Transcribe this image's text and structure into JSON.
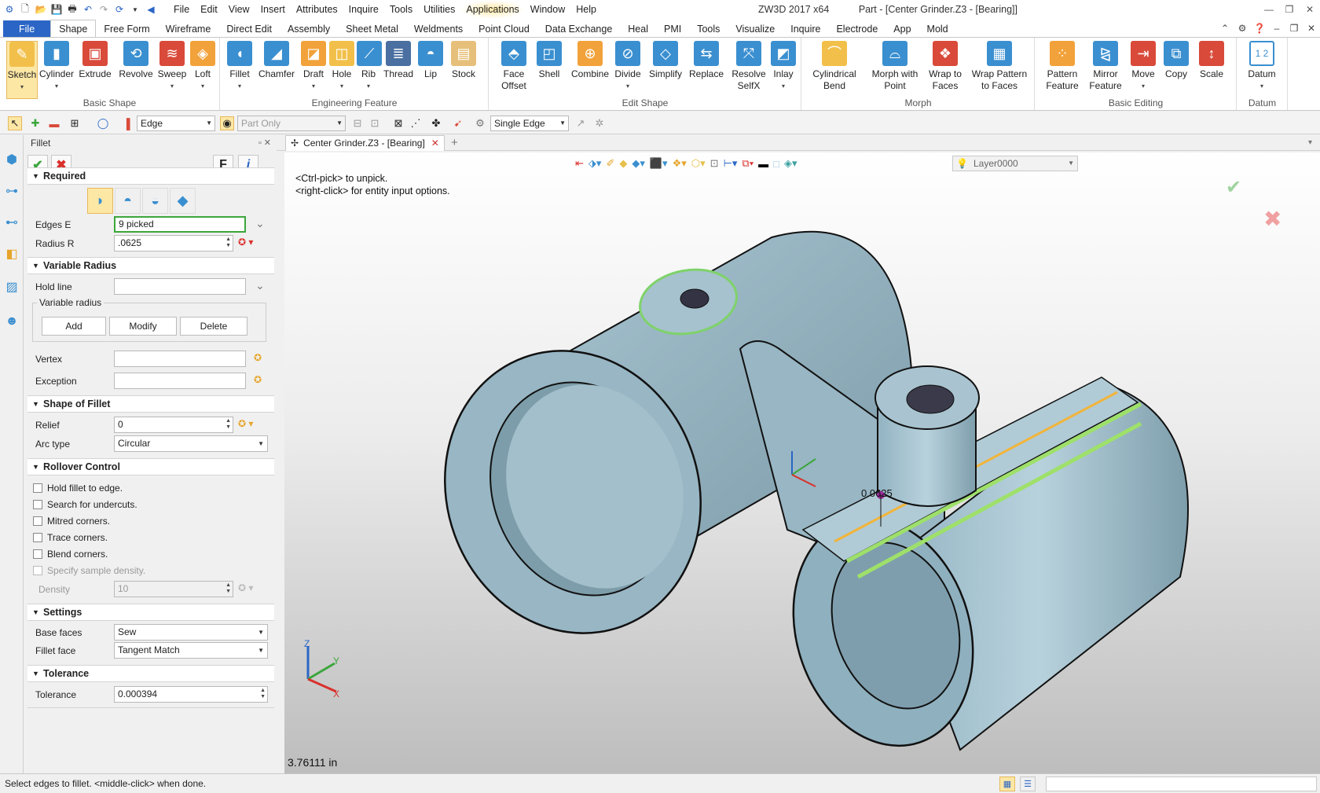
{
  "title_bar": {
    "app_version": "ZW3D 2017  x64",
    "doc_title": "Part - [Center Grinder.Z3 - [Bearing]]",
    "menu": [
      "File",
      "Edit",
      "View",
      "Insert",
      "Attributes",
      "Inquire",
      "Tools",
      "Utilities",
      "Applications",
      "Window",
      "Help"
    ]
  },
  "ribbon_tabs": [
    "Shape",
    "Free Form",
    "Wireframe",
    "Direct Edit",
    "Assembly",
    "Sheet Metal",
    "Weldments",
    "Point Cloud",
    "Data Exchange",
    "Heal",
    "PMI",
    "Tools",
    "Visualize",
    "Inquire",
    "Electrode",
    "App",
    "Mold"
  ],
  "file_tab": "File",
  "ribbon": {
    "basic_shape": {
      "label": "Basic Shape",
      "buttons": [
        {
          "l1": "Sketch",
          "l2": ""
        },
        {
          "l1": "Cylinder",
          "l2": ""
        },
        {
          "l1": "Extrude",
          "l2": ""
        },
        {
          "l1": "Revolve",
          "l2": ""
        },
        {
          "l1": "Sweep",
          "l2": ""
        },
        {
          "l1": "Loft",
          "l2": ""
        }
      ]
    },
    "engineering": {
      "label": "Engineering Feature",
      "buttons": [
        {
          "l1": "Fillet",
          "l2": ""
        },
        {
          "l1": "Chamfer",
          "l2": ""
        },
        {
          "l1": "Draft",
          "l2": ""
        },
        {
          "l1": "Hole",
          "l2": ""
        },
        {
          "l1": "Rib",
          "l2": ""
        },
        {
          "l1": "Thread",
          "l2": ""
        },
        {
          "l1": "Lip",
          "l2": ""
        },
        {
          "l1": "Stock",
          "l2": ""
        }
      ]
    },
    "edit_shape": {
      "label": "Edit Shape",
      "buttons": [
        {
          "l1": "Face",
          "l2": "Offset"
        },
        {
          "l1": "Shell",
          "l2": ""
        },
        {
          "l1": "Combine",
          "l2": ""
        },
        {
          "l1": "Divide",
          "l2": ""
        },
        {
          "l1": "Simplify",
          "l2": ""
        },
        {
          "l1": "Replace",
          "l2": ""
        },
        {
          "l1": "Resolve",
          "l2": "SelfX"
        },
        {
          "l1": "Inlay",
          "l2": ""
        }
      ]
    },
    "morph": {
      "label": "Morph",
      "buttons": [
        {
          "l1": "Cylindrical",
          "l2": "Bend"
        },
        {
          "l1": "Morph with",
          "l2": "Point"
        },
        {
          "l1": "Wrap to",
          "l2": "Faces"
        },
        {
          "l1": "Wrap Pattern",
          "l2": "to Faces"
        }
      ]
    },
    "basic_editing": {
      "label": "Basic Editing",
      "buttons": [
        {
          "l1": "Pattern",
          "l2": "Feature"
        },
        {
          "l1": "Mirror",
          "l2": "Feature"
        },
        {
          "l1": "Move",
          "l2": ""
        },
        {
          "l1": "Copy",
          "l2": ""
        },
        {
          "l1": "Scale",
          "l2": ""
        }
      ]
    },
    "datum": {
      "label": "Datum",
      "buttons": [
        {
          "l1": "Datum",
          "l2": ""
        }
      ]
    }
  },
  "filterbar": {
    "filter": "Edge",
    "scope": "Part Only",
    "pick_mode": "Single Edge"
  },
  "panel": {
    "title": "Fillet",
    "f_button": "F",
    "info_button": "i",
    "required": {
      "header": "Required",
      "edges_label": "Edges E",
      "edges_value": "9 picked",
      "radius_label": "Radius R",
      "radius_value": ".0625"
    },
    "variable_radius": {
      "header": "Variable Radius",
      "hold_line_label": "Hold line",
      "group_label": "Variable radius",
      "add": "Add",
      "modify": "Modify",
      "delete": "Delete",
      "vertex_label": "Vertex",
      "exception_label": "Exception"
    },
    "shape": {
      "header": "Shape of Fillet",
      "relief_label": "Relief",
      "relief_value": "0",
      "arc_type_label": "Arc type",
      "arc_type_value": "Circular"
    },
    "rollover": {
      "header": "Rollover Control",
      "options": [
        "Hold fillet to edge.",
        "Search for undercuts.",
        "Mitred corners.",
        "Trace corners.",
        "Blend corners."
      ],
      "sample_density": "Specify sample density.",
      "density_label": "Density",
      "density_value": "10"
    },
    "settings": {
      "header": "Settings",
      "base_faces_label": "Base faces",
      "base_faces_value": "Sew",
      "fillet_face_label": "Fillet face",
      "fillet_face_value": "Tangent Match"
    },
    "tolerance": {
      "header": "Tolerance",
      "label": "Tolerance",
      "value": "0.000394"
    }
  },
  "doc_tab": "Center Grinder.Z3 - [Bearing]",
  "viewport": {
    "hint1": "<Ctrl-pick> to unpick.",
    "hint2": "<right-click> for entity input options.",
    "layer": "Layer0000",
    "measure": "3.76111 in",
    "dim_label": "0.0625",
    "axis_x": "X",
    "axis_y": "Y",
    "axis_z": "Z"
  },
  "status": "Select edges to fillet.  <middle-click> when done."
}
